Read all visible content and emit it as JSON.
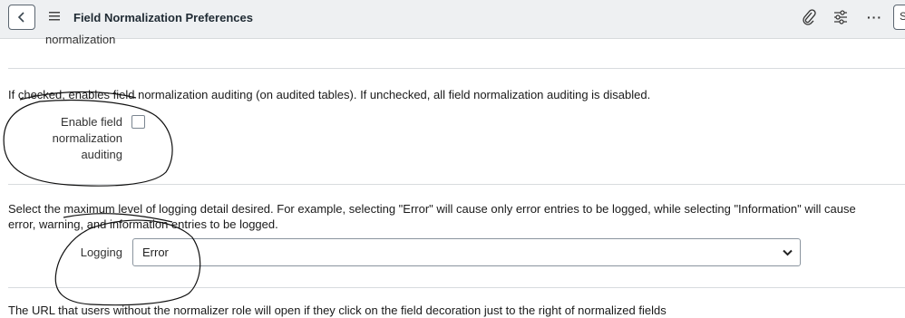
{
  "header": {
    "title": "Field Normalization Preferences",
    "back_icon": "chevron-left-icon",
    "menu_icon": "hamburger-menu-icon",
    "attachment_icon": "paperclip-icon",
    "settings_icon": "sliders-icon",
    "more_icon": "more-options-icon",
    "more_glyph": "···",
    "edge_button_glyph": "S"
  },
  "sections": {
    "clipped_label": "normalization",
    "auditing": {
      "help": "If checked, enables field normalization auditing (on audited tables). If unchecked, all field normalization auditing is disabled.",
      "label_lines": [
        "Enable field",
        "normalization",
        "auditing"
      ],
      "checked": false
    },
    "logging": {
      "help_line1": "Select the maximum level of logging detail desired. For example, selecting \"Error\" will cause only error entries to be logged, while selecting \"Information\" will cause",
      "help_line2": "error, warning, and information entries to be logged.",
      "label": "Logging",
      "selected": "Error"
    },
    "url_help_partial": "The URL that users without the normalizer role will open if they click on the field decoration just to the right of normalized fields"
  },
  "colors": {
    "header_bg": "#eef0f2",
    "annotation_ink": "#111111"
  }
}
